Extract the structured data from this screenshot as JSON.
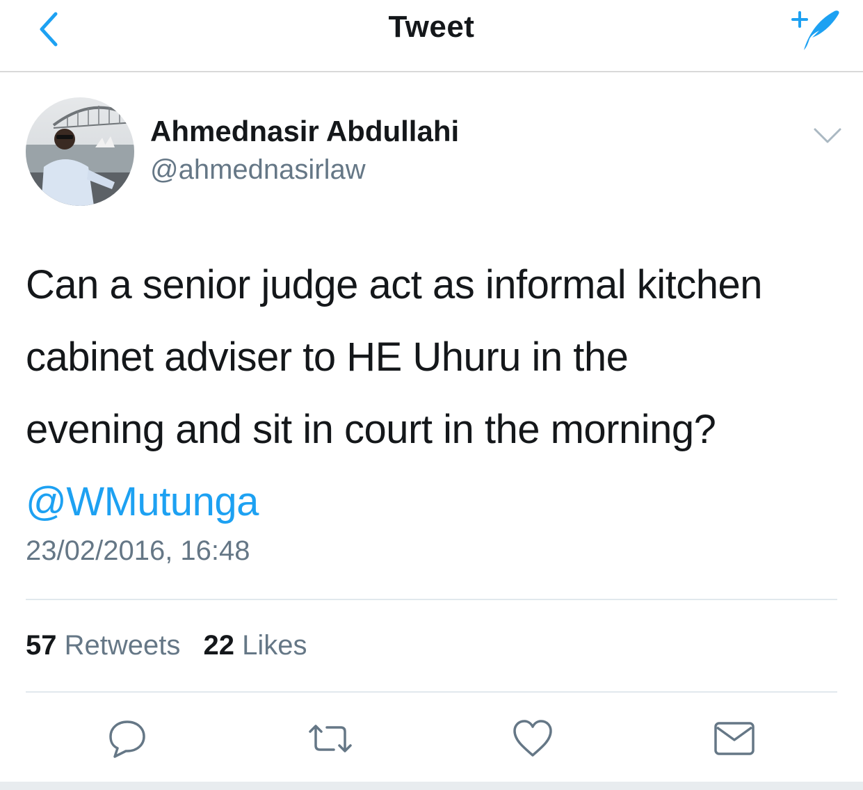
{
  "navbar": {
    "title": "Tweet",
    "back_icon": "chevron-left-icon",
    "compose_icon": "compose-tweet-icon"
  },
  "author": {
    "name": "Ahmednasir Abdullahi",
    "handle": "@ahmednasirlaw",
    "menu_icon": "chevron-down-icon"
  },
  "tweet": {
    "lines": [
      "Can a senior judge act as informal kitchen",
      "cabinet adviser to HE Uhuru in the",
      "evening and sit in court in the morning?"
    ],
    "mention": "@WMutunga",
    "timestamp": "23/02/2016, 16:48"
  },
  "stats": {
    "retweets_count": "57",
    "retweets_label": "Retweets",
    "likes_count": "22",
    "likes_label": "Likes"
  },
  "actions": [
    {
      "name": "reply",
      "icon": "reply-icon"
    },
    {
      "name": "retweet",
      "icon": "retweet-icon"
    },
    {
      "name": "like",
      "icon": "heart-icon"
    },
    {
      "name": "message",
      "icon": "envelope-icon"
    }
  ],
  "colors": {
    "accent": "#1da1f2",
    "text": "#14171a",
    "secondary": "#657786",
    "icon_gray": "#657786",
    "divider": "#e1e8ed"
  }
}
